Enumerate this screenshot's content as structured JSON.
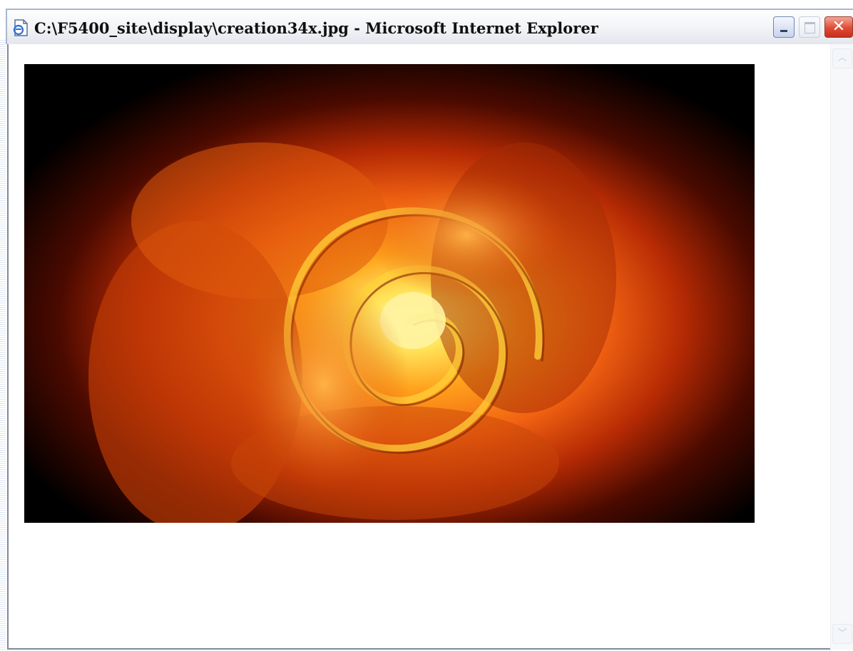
{
  "window": {
    "title": "C:\\F5400_site\\display\\creation34x.jpg - Microsoft Internet Explorer",
    "close_glyph": "✕"
  },
  "icons": {
    "app": "ie-page-icon",
    "minimize": "minimize-icon",
    "maximize": "maximize-icon",
    "close": "close-icon",
    "scroll_up": "chevron-up-icon",
    "scroll_down": "chevron-down-icon"
  },
  "content": {
    "image_subject": "close-up of an orange and yellow rose on black background"
  },
  "scrollbar": {
    "up_glyph": "︿",
    "down_glyph": "﹀"
  },
  "colors": {
    "title_bar_top": "#fefefe",
    "title_bar_bottom": "#e3e6ec",
    "close_button": "#e04a34",
    "rose_core": "#ffe86a",
    "rose_mid": "#ff7a12",
    "rose_outer": "#7a1400",
    "background": "#000000"
  }
}
